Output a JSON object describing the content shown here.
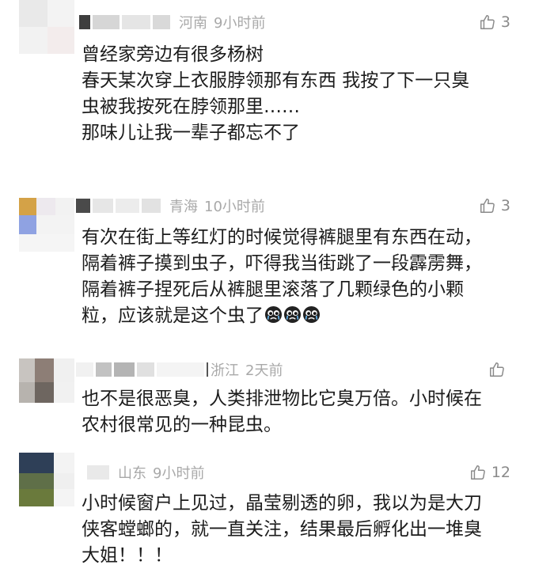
{
  "comments": [
    {
      "location": "河南",
      "time": "9小时前",
      "likes": "3",
      "lines": [
        "曾经家旁边有很多杨树",
        "春天某次穿上衣服脖领那有东西 我按了下一只臭",
        "虫被我按死在脖领那里……",
        "那味儿让我一辈子都忘不了"
      ]
    },
    {
      "location": "青海",
      "time": "10小时前",
      "likes": "3",
      "lines": [
        "有次在街上等红灯的时候觉得裤腿里有东西在动，",
        "隔着裤子摸到虫子，吓得我当街跳了一段霹雳舞，",
        "隔着裤子捏死后从裤腿里滚落了几颗绿色的小颗",
        "粒，应该就是这个虫了"
      ],
      "emoji": "crying-face-icon"
    },
    {
      "location": "浙江",
      "time": "2天前",
      "likes": "",
      "lines": [
        "也不是很恶臭，人类排泄物比它臭万倍。小时候在",
        "农村很常见的一种昆虫。"
      ]
    },
    {
      "location": "山东",
      "time": "9小时前",
      "likes": "12",
      "lines": [
        "小时候窗户上见过，晶莹剔透的卵，我以为是大刀",
        "侠客螳螂的，就一直关注，结果最后孵化出一堆臭",
        "大姐！！！"
      ]
    }
  ],
  "icons": {
    "like": "thumbs-up-icon"
  },
  "colors": {
    "meta": "#a9a9a9",
    "text": "#1c1c1c",
    "like": "#8a8a8a"
  }
}
